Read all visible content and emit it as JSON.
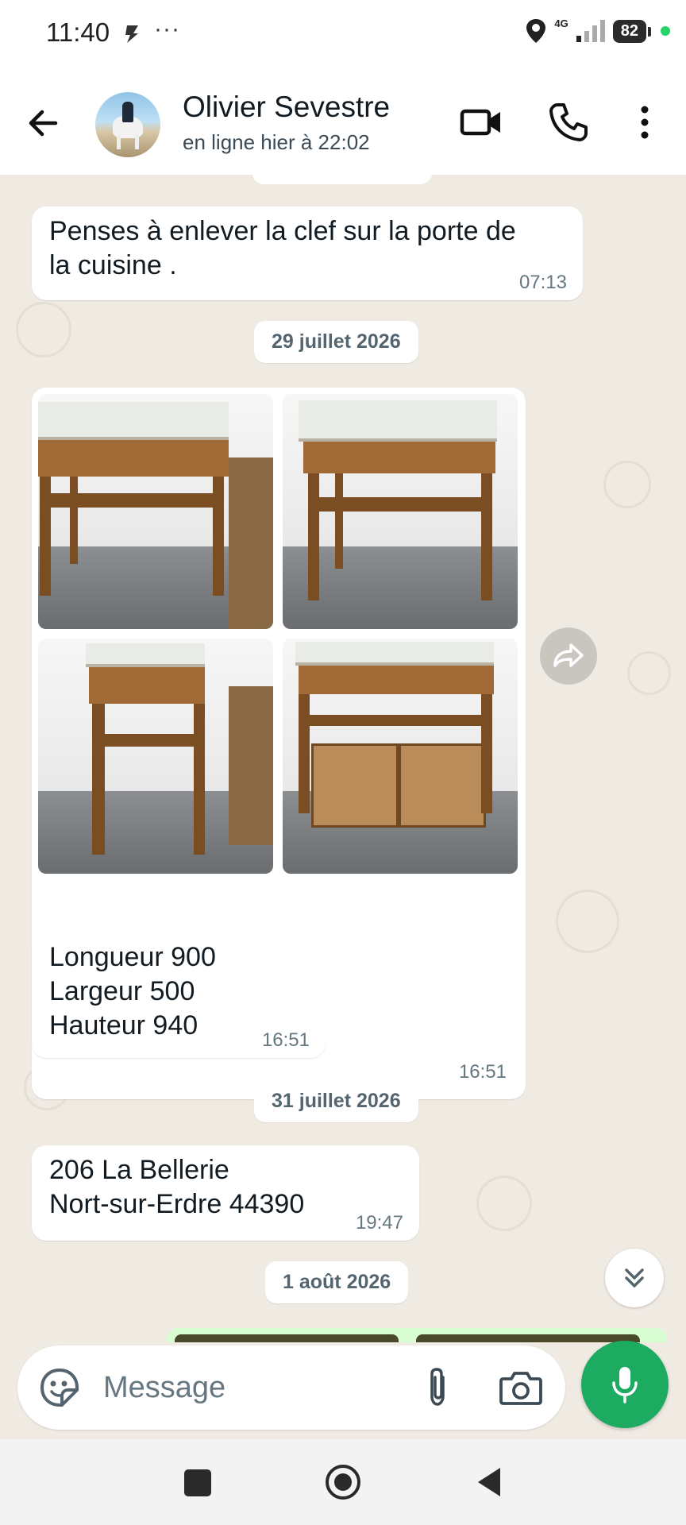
{
  "status_bar": {
    "time": "11:40",
    "more": "···",
    "network": "4G",
    "battery": "82"
  },
  "header": {
    "contact_name": "Olivier Sevestre",
    "contact_status": "en ligne hier à 22:02"
  },
  "messages": [
    {
      "text": "Penses à  enlever la clef sur la porte de\nla cuisine .",
      "time": "07:13"
    },
    {
      "date": "29 juillet 2026"
    },
    {
      "photos": 4,
      "time": "16:51"
    },
    {
      "text": "Longueur 900\nLargeur 500\nHauteur 940",
      "time": "16:51"
    },
    {
      "date": "31 juillet 2026"
    },
    {
      "text": "206 La Bellerie\nNort-sur-Erdre 44390",
      "time": "19:47"
    },
    {
      "date": "1 août 2026"
    }
  ],
  "input": {
    "placeholder": "Message"
  },
  "icons": {
    "back": "arrow-left-icon",
    "video": "video-camera-icon",
    "call": "phone-icon",
    "menu": "more-vertical-icon",
    "forward": "forward-icon",
    "scroll": "double-chevron-down-icon",
    "emoji": "sticker-icon",
    "attach": "paperclip-icon",
    "camera": "camera-icon",
    "mic": "microphone-icon"
  },
  "colors": {
    "accent": "#1daa61",
    "chat_bg": "#efeae2",
    "bubble": "#ffffff"
  }
}
